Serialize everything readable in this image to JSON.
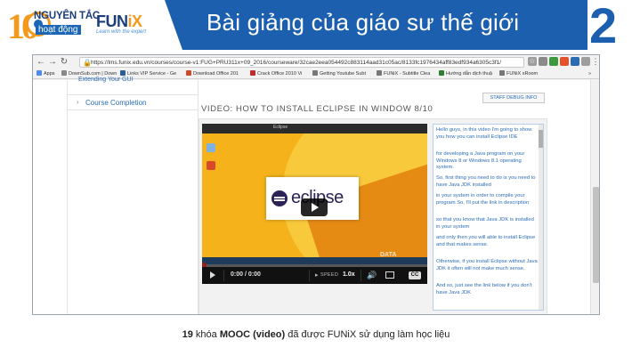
{
  "slide": {
    "logo": {
      "number": "10",
      "line1": "NGUYÊN TẮC",
      "line2_prefix": "",
      "line2_highlight": "hoạt động",
      "brand_prefix": "FUN",
      "brand_suffix": "iX",
      "tagline": "Learn with the expert"
    },
    "title": "Bài giảng của giáo sư thế giới",
    "number": "2",
    "caption": {
      "count": "19",
      "text_a": " khóa ",
      "bold": "MOOC (video)",
      "text_b": " đã được FUNiX sử dụng làm học liệu"
    },
    "colors": {
      "brand_blue": "#1b5fae",
      "brand_orange": "#f39a1e"
    }
  },
  "browser": {
    "url_scheme": "https://",
    "url": "https://lms.funix.edu.vn/courses/course-v1:FUG+PRU311x+09_2016/courseware/32cae2eea054492c883114aad31c05ac/8133fc1976434aff83edf934a6305c3f1/",
    "bookmarks": [
      "Apps",
      "DownSub.com | Down",
      "Links VIP Service - Ge",
      "Download Office 201",
      "Crack Office 2010 Vi",
      "Getting Youtube Subt",
      "FUNiX - Subtitle Clea",
      "Hướng dẫn dịch thuậ",
      "FUNiX xRoom"
    ],
    "bookmarks_overflow": "»"
  },
  "page": {
    "nav_cut_label": "Extending Your GUI",
    "nav_link": "Course Completion",
    "staff_button": "STAFF DEBUG INFO",
    "video_title": "VIDEO: HOW TO INSTALL ECLIPSE IN WINDOW 8/10",
    "player": {
      "time": "0:00 / 0:00",
      "speed_label": "SPEED",
      "speed_value": "1.0x",
      "cc": "CC",
      "watermark": "DATA",
      "splash_word": "eclipse",
      "desktop_title": "Eclipse"
    },
    "transcript": [
      "Hello guys, in this video I'm going to show you how you can install Eclipse IDE",
      "for developing a Java program on your Windows 8 or Windows 8.1 operating system.",
      "So, first thing you need to do is you need to have Java JDK installed",
      "in your system in order to compile your program So, I'll put the link in description",
      "so that you know that Java JDK is installed in your system",
      "and only then you will able to install Eclipse and that makes sense.",
      "Otherwise, if you install Eclipse without Java JDK it often will not make much sense.",
      "And so, just see the link below if you don't have Java JDK"
    ]
  }
}
